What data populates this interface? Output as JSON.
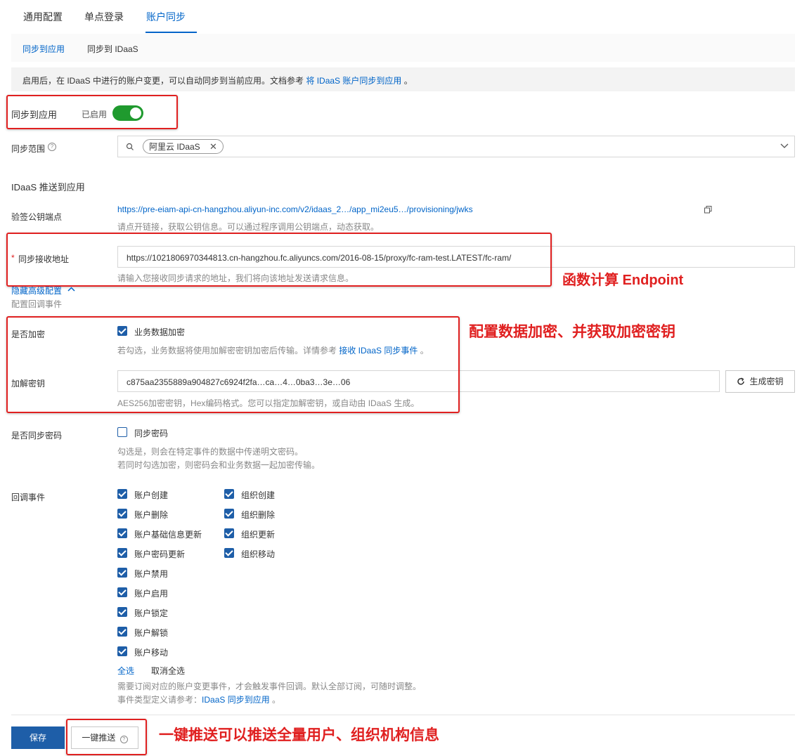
{
  "tabs": [
    {
      "label": "通用配置"
    },
    {
      "label": "单点登录"
    },
    {
      "label": "账户同步"
    }
  ],
  "subtabs": [
    {
      "label": "同步到应用"
    },
    {
      "label": "同步到 IDaaS"
    }
  ],
  "notice": {
    "text": "启用后，在 IDaaS 中进行的账户变更，可以自动同步到当前应用。文档参考 ",
    "link": "将 IDaaS 账户同步到应用",
    "suffix": " 。"
  },
  "sync_toggle": {
    "label": "同步到应用",
    "status": "已启用",
    "enabled": true
  },
  "sync_scope": {
    "label": "同步范围",
    "tag": "阿里云 IDaaS"
  },
  "section_title": "IDaaS 推送到应用",
  "verify_key": {
    "label": "验签公钥端点",
    "url": "https://pre-eiam-api-cn-hangzhou.aliyun-inc.com/v2/idaas_2…/app_mi2eu5…/provisioning/jwks",
    "hint": "请点开链接，获取公钥信息。可以通过程序调用公钥端点，动态获取。"
  },
  "receive_url": {
    "required_mark": "*",
    "label": "同步接收地址",
    "value": "https://1021806970344813.cn-hangzhou.fc.aliyuncs.com/2016-08-15/proxy/fc-ram-test.LATEST/fc-ram/",
    "hint": "请输入您接收同步请求的地址，我们将向该地址发送请求信息。"
  },
  "advanced": {
    "toggle": "隐藏高级配置",
    "sub": "配置回调事件"
  },
  "encrypt": {
    "label": "是否加密",
    "checkbox": "业务数据加密",
    "checked": true,
    "hint": "若勾选，业务数据将使用加解密密钥加密后传输。详情参考 ",
    "hint_link": "接收 IDaaS 同步事件",
    "hint_suffix": " 。"
  },
  "secret": {
    "label": "加解密钥",
    "value": "c875aa2355889a904827c6924f2fa…ca…4…0ba3…3e…06",
    "gen_button": "生成密钥",
    "hint": "AES256加密密钥，Hex编码格式。您可以指定加解密钥，或自动由 IDaaS 生成。"
  },
  "sync_password": {
    "label": "是否同步密码",
    "checkbox": "同步密码",
    "checked": false,
    "hint1": "勾选是，则会在特定事件的数据中传递明文密码。",
    "hint2": "若同时勾选加密，则密码会和业务数据一起加密传输。"
  },
  "events": {
    "label": "回调事件",
    "account_events": [
      "账户创建",
      "账户删除",
      "账户基础信息更新",
      "账户密码更新",
      "账户禁用",
      "账户启用",
      "账户锁定",
      "账户解锁",
      "账户移动"
    ],
    "org_events": [
      "组织创建",
      "组织删除",
      "组织更新",
      "组织移动"
    ],
    "select_all": "全选",
    "deselect_all": "取消全选",
    "hint1": "需要订阅对应的账户变更事件，才会触发事件回调。默认全部订阅，可随时调整。",
    "hint2": "事件类型定义请参考：",
    "hint2_link": "IDaaS 同步到应用",
    "hint2_suffix": " 。"
  },
  "footer": {
    "save": "保存",
    "push": "一键推送"
  },
  "annotations": {
    "endpoint": "函数计算 Endpoint",
    "encryption": "配置数据加密、并获取加密密钥",
    "push": "一键推送可以推送全量用户、组织机构信息"
  },
  "colors": {
    "primary": "#0064c8",
    "button": "#1e5ea8",
    "toggle_on": "#1f9a2e",
    "annotation": "#e02020"
  }
}
